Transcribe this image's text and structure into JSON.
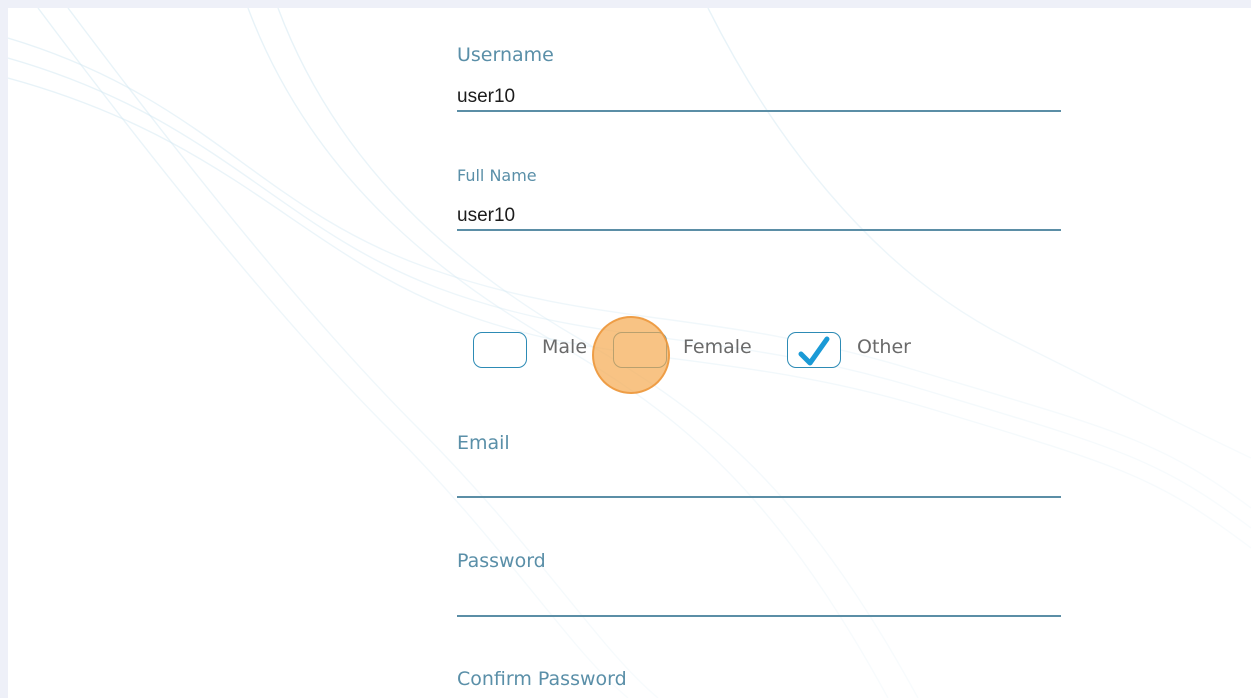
{
  "form": {
    "username": {
      "label": "Username",
      "value": "user10"
    },
    "full_name": {
      "label": "Full Name",
      "value": "user10"
    },
    "gender": {
      "options": [
        {
          "label": "Male",
          "checked": false
        },
        {
          "label": "Female",
          "checked": false
        },
        {
          "label": "Other",
          "checked": true
        }
      ]
    },
    "email": {
      "label": "Email",
      "value": ""
    },
    "password": {
      "label": "Password",
      "value": ""
    },
    "confirm_password": {
      "label": "Confirm Password"
    }
  },
  "colors": {
    "accent": "#2d8bb5",
    "label": "#5a8fa8",
    "underline": "#5b8ea6",
    "checkmark": "#1a9ad6",
    "click_indicator": "#f5aa50"
  },
  "icons": {
    "checkbox_checked": "checkmark-icon",
    "click_indicator": "click-cursor-highlight"
  }
}
